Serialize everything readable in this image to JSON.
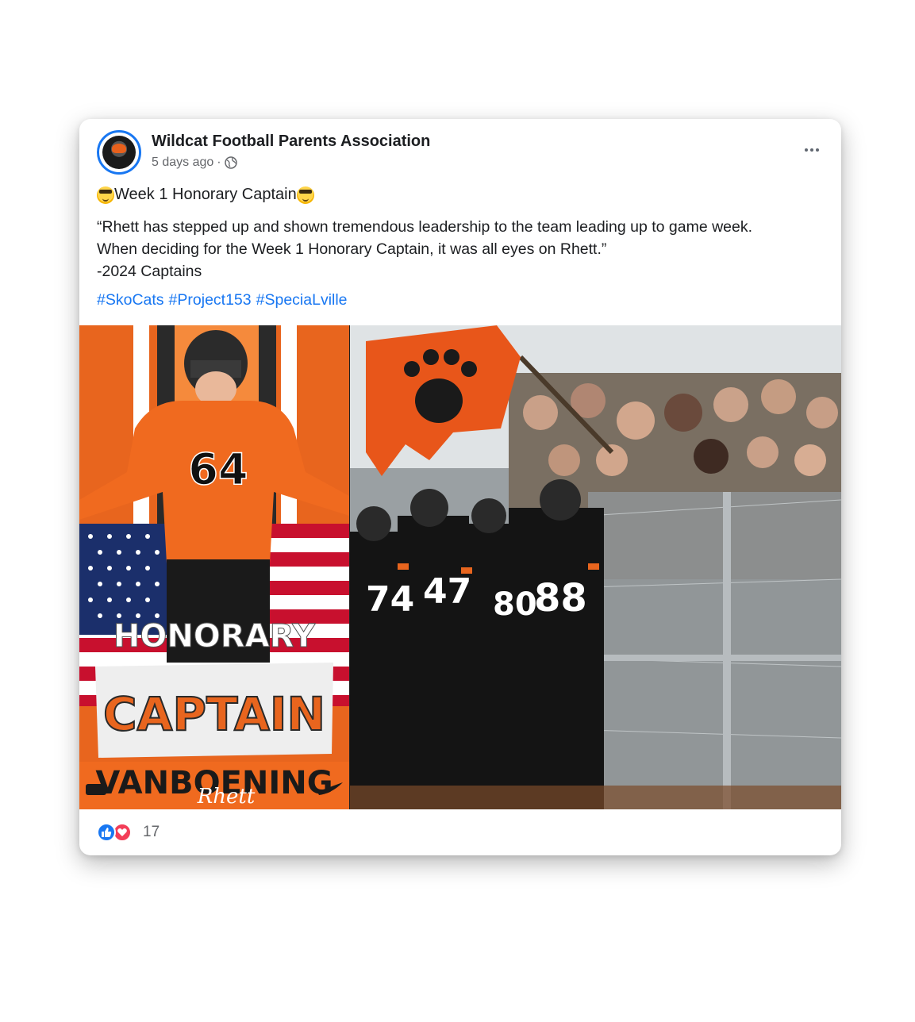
{
  "post": {
    "page_name": "Wildcat Football Parents Association",
    "timestamp": "5 days ago",
    "separator": "·",
    "title": "Week 1 Honorary Captain",
    "body_lines": [
      "“Rhett has stepped up and shown tremendous leadership to the team leading up to game week.",
      "When deciding for the Week 1 Honorary Captain, it was all eyes on Rhett.”",
      "-2024 Captains"
    ],
    "hashtags": [
      "#SkoCats",
      "#Project153",
      "#SpeciaLville"
    ],
    "reaction_count": "17"
  },
  "photo_left": {
    "jersey_number": "64",
    "word_top": "HONORARY",
    "word_main": "CAPTAIN",
    "last_name": "VANBOENING",
    "first_name": "Rhett"
  },
  "photo_right": {
    "jersey_numbers": [
      "74",
      "47",
      "80",
      "88"
    ]
  },
  "icons": {
    "avatar": "team-logo",
    "privacy": "globe-icon",
    "more": "more-options-icon",
    "emoji": "face-emoji-icon",
    "like": "like-reaction-icon",
    "love": "love-reaction-icon"
  },
  "colors": {
    "link": "#1877f2",
    "text": "#1c1e21",
    "meta": "#65676b",
    "team_orange": "#e8651e"
  }
}
